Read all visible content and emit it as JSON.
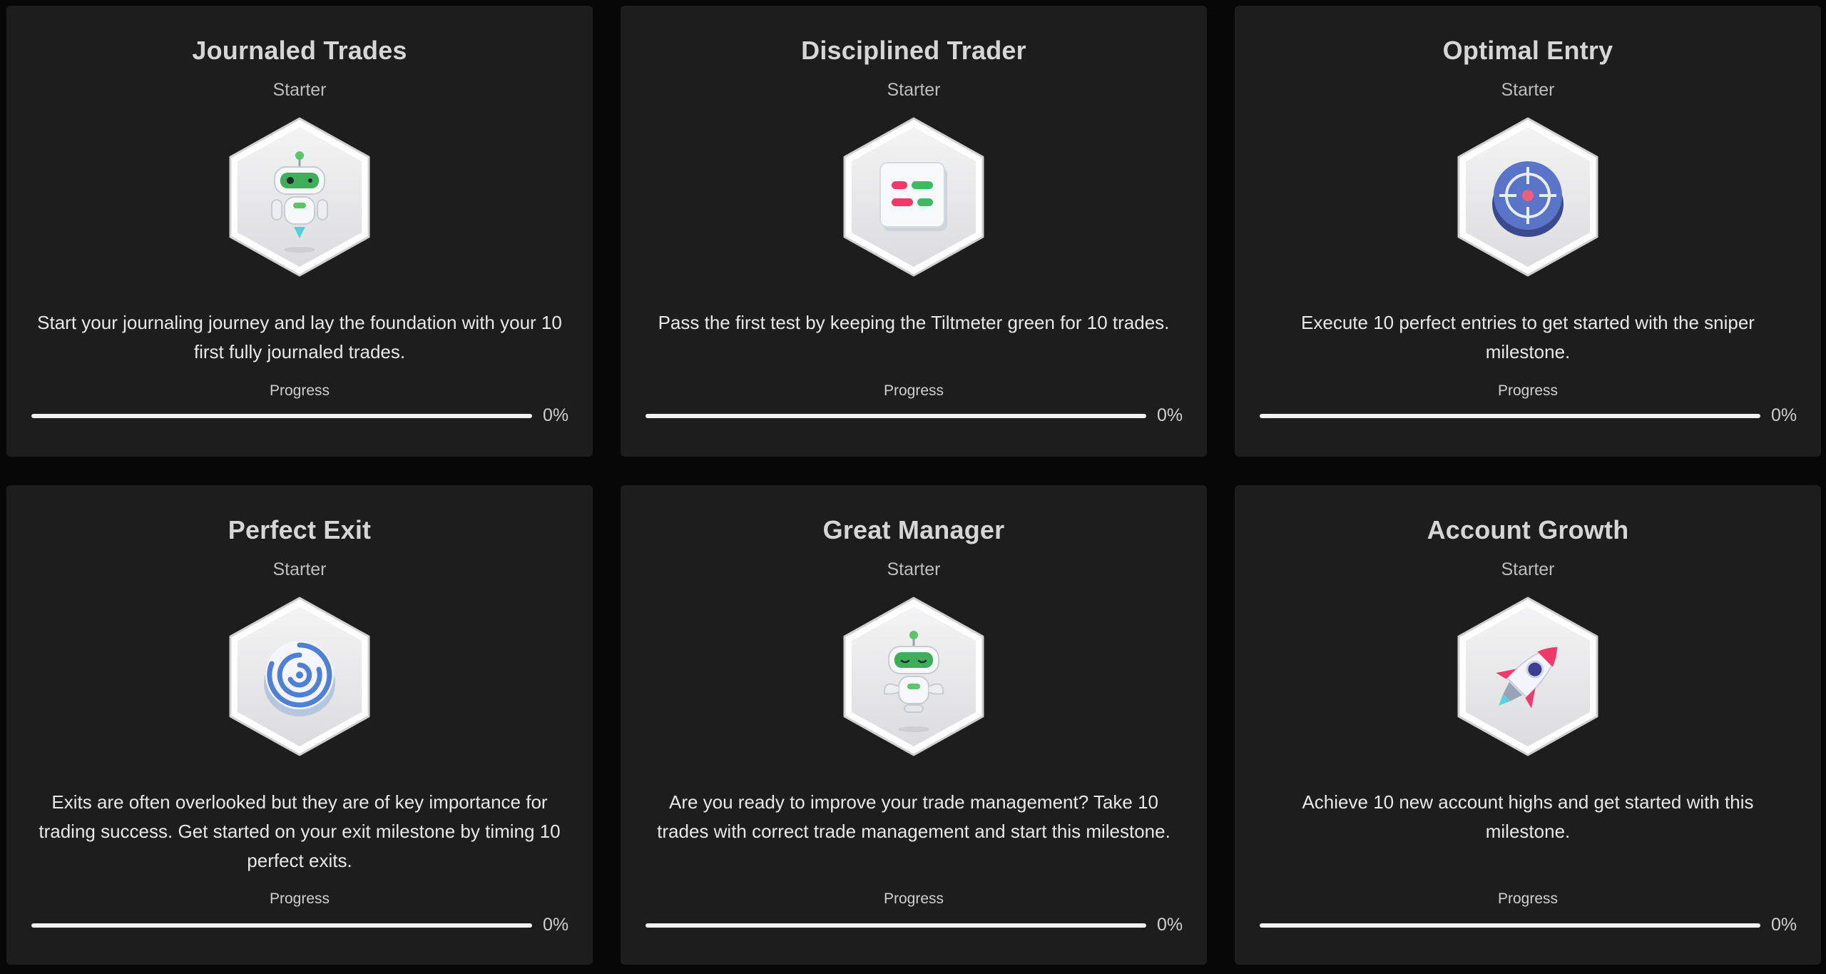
{
  "progress_label": "Progress",
  "cards": [
    {
      "title": "Journaled Trades",
      "tier": "Starter",
      "icon": "robot-icon",
      "description": "Start your journaling journey and lay the foundation with your 10 first fully journaled trades.",
      "progress_percent": 0,
      "progress_text": "0%"
    },
    {
      "title": "Disciplined Trader",
      "tier": "Starter",
      "icon": "tiltmeter-icon",
      "description": "Pass the first test by keeping the Tiltmeter green for 10 trades.",
      "progress_percent": 0,
      "progress_text": "0%"
    },
    {
      "title": "Optimal Entry",
      "tier": "Starter",
      "icon": "crosshair-target-icon",
      "description": "Execute 10 perfect entries to get started with the sniper milestone.",
      "progress_percent": 0,
      "progress_text": "0%"
    },
    {
      "title": "Perfect Exit",
      "tier": "Starter",
      "icon": "maze-icon",
      "description": "Exits are often overlooked but they are of key importance for trading success. Get started on your exit milestone by timing 10 perfect exits.",
      "progress_percent": 0,
      "progress_text": "0%"
    },
    {
      "title": "Great Manager",
      "tier": "Starter",
      "icon": "robot-manager-icon",
      "description": "Are you ready to improve your trade management? Take 10 trades with correct trade management and start this milestone.",
      "progress_percent": 0,
      "progress_text": "0%"
    },
    {
      "title": "Account Growth",
      "tier": "Starter",
      "icon": "rocket-icon",
      "description": "Achieve 10 new account highs and get started with this milestone.",
      "progress_percent": 0,
      "progress_text": "0%"
    }
  ],
  "colors": {
    "background": "#070707",
    "card": "#1d1d1e",
    "progress_track": "#f2f2f2",
    "badge_face": "#e9e9ea"
  }
}
